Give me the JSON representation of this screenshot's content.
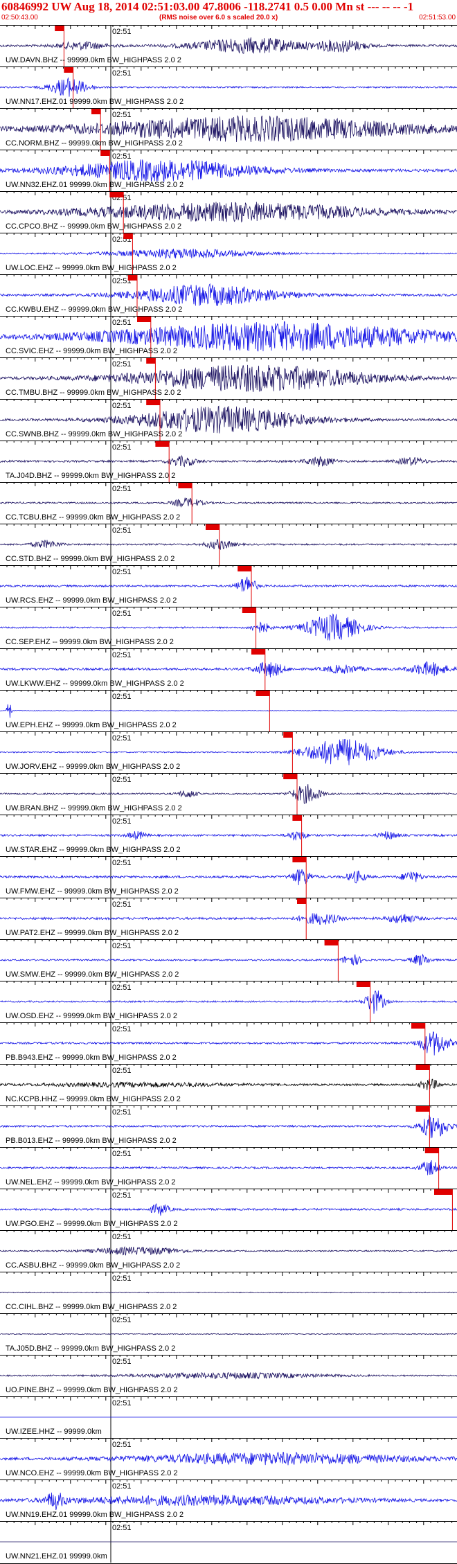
{
  "header": {
    "title": "60846992 UW Aug 18, 2014 02:51:03.00   47.8006 -118.2741  0.5 0.00 Mn st --- -- --  -1",
    "start_time": "02:50:43.00",
    "end_time": "02:51:53.00",
    "note": "(RMS noise over 6.0 s scaled 20.0 x)"
  },
  "minute_label": "02:51",
  "colors": {
    "grid": "#000000",
    "accent": "#e00000",
    "navy": "#1a1060",
    "blue": "#1515e6",
    "black": "#000000"
  },
  "traces": [
    {
      "label": "UW.DAVN.BHZ -- 99999.0km BW_HIGHPASS  2.0  2",
      "color": "navy",
      "amp": 0.35,
      "pick": [
        0.12,
        0.14
      ],
      "bursts": [
        [
          0.55,
          0.12,
          0.8
        ],
        [
          0.75,
          0.05,
          0.6
        ],
        [
          0.18,
          0.05,
          0.4
        ]
      ]
    },
    {
      "label": "UW.NN17.EHZ.01 99999.0km BW_HIGHPASS  2.0  2",
      "color": "blue",
      "amp": 0.25,
      "pick": [
        0.14,
        0.16
      ],
      "bursts": [
        [
          0.15,
          0.04,
          1.0
        ]
      ]
    },
    {
      "label": "CC.NORM.BHZ -- 99999.0km BW_HIGHPASS  2.0  2",
      "color": "navy",
      "amp": 0.45,
      "pick": [
        0.2,
        0.22
      ],
      "bursts": [
        [
          0.55,
          0.35,
          1.3
        ]
      ]
    },
    {
      "label": "UW.NN32.EHZ.01 99999.0km BW_HIGHPASS  2.0  2",
      "color": "blue",
      "amp": 0.45,
      "pick": [
        0.22,
        0.24
      ],
      "bursts": [
        [
          0.35,
          0.2,
          1.1
        ]
      ]
    },
    {
      "label": "CC.CPCO.BHZ -- 99999.0km BW_HIGHPASS  2.0  2",
      "color": "navy",
      "amp": 0.4,
      "pick": [
        0.24,
        0.27
      ],
      "bursts": [
        [
          0.5,
          0.3,
          1.0
        ]
      ]
    },
    {
      "label": "UW.LOC.EHZ -- 99999.0km BW_HIGHPASS  2.0  2",
      "color": "blue",
      "amp": 0.2,
      "pick": [
        0.27,
        0.29
      ],
      "bursts": [
        [
          0.4,
          0.15,
          0.5
        ]
      ]
    },
    {
      "label": "CC.KWBU.EHZ -- 99999.0km BW_HIGHPASS  2.0  2",
      "color": "blue",
      "amp": 0.35,
      "pick": [
        0.28,
        0.3
      ],
      "bursts": [
        [
          0.45,
          0.15,
          1.1
        ]
      ]
    },
    {
      "label": "CC.SVIC.EHZ -- 99999.0km BW_HIGHPASS  2.0  2",
      "color": "blue",
      "amp": 0.5,
      "pick": [
        0.3,
        0.33
      ],
      "bursts": [
        [
          0.6,
          0.35,
          1.5
        ]
      ]
    },
    {
      "label": "CC.TMBU.BHZ -- 99999.0km BW_HIGHPASS  2.0  2",
      "color": "navy",
      "amp": 0.4,
      "pick": [
        0.32,
        0.34
      ],
      "bursts": [
        [
          0.55,
          0.25,
          1.4
        ]
      ]
    },
    {
      "label": "CC.SWNB.BHZ -- 99999.0km BW_HIGHPASS  2.0  2",
      "color": "navy",
      "amp": 0.35,
      "pick": [
        0.32,
        0.35
      ],
      "bursts": [
        [
          0.48,
          0.18,
          1.4
        ]
      ]
    },
    {
      "label": "TA.J04D.BHZ -- 99999.0km BW_HIGHPASS  2.0  2",
      "color": "navy",
      "amp": 0.3,
      "pick": [
        0.34,
        0.37
      ],
      "bursts": [
        [
          0.4,
          0.03,
          0.5
        ],
        [
          0.7,
          0.03,
          0.5
        ],
        [
          0.9,
          0.03,
          0.4
        ]
      ]
    },
    {
      "label": "CC.TCBU.BHZ -- 99999.0km BW_HIGHPASS  2.0  2",
      "color": "navy",
      "amp": 0.25,
      "pick": [
        0.39,
        0.42
      ],
      "bursts": [
        [
          0.41,
          0.03,
          0.5
        ]
      ]
    },
    {
      "label": "CC.STD.BHZ -- 99999.0km BW_HIGHPASS  2.0  2",
      "color": "navy",
      "amp": 0.25,
      "pick": [
        0.45,
        0.48
      ],
      "bursts": [
        [
          0.1,
          0.03,
          0.4
        ],
        [
          0.48,
          0.03,
          0.5
        ]
      ]
    },
    {
      "label": "UW.RCS.EHZ -- 99999.0km BW_HIGHPASS  2.0  2",
      "color": "blue",
      "amp": 0.3,
      "pick": [
        0.52,
        0.55
      ],
      "bursts": [
        [
          0.54,
          0.02,
          1.0
        ]
      ]
    },
    {
      "label": "CC.SEP.EHZ -- 99999.0km BW_HIGHPASS  2.0  2",
      "color": "blue",
      "amp": 0.25,
      "pick": [
        0.53,
        0.56
      ],
      "bursts": [
        [
          0.73,
          0.06,
          1.4
        ],
        [
          0.57,
          0.02,
          0.6
        ]
      ]
    },
    {
      "label": "UW.LKWW.EHZ -- 99999.0km BW_HIGHPASS  2.0  2",
      "color": "blue",
      "amp": 0.35,
      "pick": [
        0.55,
        0.58
      ],
      "bursts": [
        [
          0.59,
          0.03,
          0.8
        ],
        [
          0.94,
          0.04,
          0.7
        ],
        [
          0.75,
          0.04,
          0.4
        ]
      ]
    },
    {
      "label": "UW.EPH.EHZ -- 99999.0km BW_HIGHPASS  2.0  2",
      "color": "blue",
      "amp": 0.1,
      "pick": [
        0.56,
        0.59
      ],
      "bursts": [
        [
          0.02,
          0.005,
          1.0
        ]
      ]
    },
    {
      "label": "UW.JORV.EHZ -- 99999.0km BW_HIGHPASS  2.0  2",
      "color": "blue",
      "amp": 0.2,
      "pick": [
        0.62,
        0.64
      ],
      "bursts": [
        [
          0.75,
          0.08,
          1.5
        ]
      ]
    },
    {
      "label": "UW.BRAN.BHZ -- 99999.0km BW_HIGHPASS  2.0  2",
      "color": "navy",
      "amp": 0.25,
      "pick": [
        0.62,
        0.65
      ],
      "bursts": [
        [
          0.67,
          0.03,
          1.0
        ],
        [
          0.41,
          0.02,
          0.4
        ]
      ]
    },
    {
      "label": "UW.STAR.EHZ -- 99999.0km BW_HIGHPASS  2.0  2",
      "color": "blue",
      "amp": 0.3,
      "pick": [
        0.64,
        0.66
      ],
      "bursts": [
        [
          0.65,
          0.02,
          0.5
        ],
        [
          0.3,
          0.02,
          0.4
        ],
        [
          0.85,
          0.02,
          0.4
        ]
      ]
    },
    {
      "label": "UW.FMW.EHZ -- 99999.0km BW_HIGHPASS  2.0  2",
      "color": "blue",
      "amp": 0.35,
      "pick": [
        0.64,
        0.67
      ],
      "bursts": [
        [
          0.66,
          0.02,
          0.9
        ],
        [
          0.78,
          0.02,
          0.6
        ],
        [
          0.9,
          0.02,
          0.6
        ]
      ]
    },
    {
      "label": "UW.PAT2.EHZ -- 99999.0km BW_HIGHPASS  2.0  2",
      "color": "blue",
      "amp": 0.35,
      "pick": [
        0.65,
        0.67
      ],
      "bursts": [
        [
          0.7,
          0.04,
          0.6
        ],
        [
          0.88,
          0.03,
          0.5
        ]
      ]
    },
    {
      "label": "UW.SMW.EHZ -- 99999.0km BW_HIGHPASS  2.0  2",
      "color": "blue",
      "amp": 0.25,
      "pick": [
        0.71,
        0.74
      ],
      "bursts": [
        [
          0.77,
          0.02,
          0.6
        ],
        [
          0.92,
          0.02,
          0.6
        ]
      ]
    },
    {
      "label": "UW.OSD.EHZ -- 99999.0km BW_HIGHPASS  2.0  2",
      "color": "blue",
      "amp": 0.25,
      "pick": [
        0.78,
        0.81
      ],
      "bursts": [
        [
          0.82,
          0.02,
          1.3
        ]
      ]
    },
    {
      "label": "PB.B943.EHZ -- 99999.0km BW_HIGHPASS  2.0  2",
      "color": "blue",
      "amp": 0.3,
      "pick": [
        0.9,
        0.93
      ],
      "bursts": [
        [
          0.95,
          0.03,
          1.3
        ]
      ]
    },
    {
      "label": "NC.KCPB.HHZ -- 99999.0km BW_HIGHPASS  2.0  2",
      "color": "black",
      "amp": 0.3,
      "pick": [
        0.91,
        0.94
      ],
      "bursts": [
        [
          0.94,
          0.02,
          0.6
        ],
        [
          0.3,
          0.2,
          0.2
        ]
      ]
    },
    {
      "label": "PB.B013.EHZ -- 99999.0km BW_HIGHPASS  2.0  2",
      "color": "blue",
      "amp": 0.3,
      "pick": [
        0.91,
        0.94
      ],
      "bursts": [
        [
          0.95,
          0.03,
          1.3
        ]
      ]
    },
    {
      "label": "UW.NEL.EHZ -- 99999.0km BW_HIGHPASS  2.0  2",
      "color": "blue",
      "amp": 0.3,
      "pick": [
        0.93,
        0.96
      ],
      "bursts": [
        [
          0.94,
          0.02,
          0.8
        ]
      ]
    },
    {
      "label": "UW.PGO.EHZ -- 99999.0km BW_HIGHPASS  2.0  2",
      "color": "blue",
      "amp": 0.3,
      "pick": [
        0.95,
        0.99
      ],
      "bursts": [
        [
          0.35,
          0.02,
          0.6
        ]
      ]
    },
    {
      "label": "CC.ASBU.BHZ -- 99999.0km BW_HIGHPASS  2.0  2",
      "color": "navy",
      "amp": 0.2,
      "pick": null,
      "bursts": [
        [
          0.3,
          0.1,
          0.4
        ]
      ]
    },
    {
      "label": "CC.CIHL.BHZ -- 99999.0km BW_HIGHPASS  2.0  2",
      "color": "navy",
      "amp": 0.15,
      "pick": null,
      "bursts": []
    },
    {
      "label": "TA.J05D.BHZ -- 99999.0km BW_HIGHPASS  2.0  2",
      "color": "navy",
      "amp": 0.15,
      "pick": null,
      "bursts": []
    },
    {
      "label": "UO.PINE.BHZ -- 99999.0km BW_HIGHPASS  2.0  2",
      "color": "navy",
      "amp": 0.2,
      "pick": null,
      "bursts": [
        [
          0.5,
          0.2,
          0.3
        ]
      ]
    },
    {
      "label": "UW.IZEE.HHZ -- 99999.0km",
      "color": "blue",
      "amp": 0.0,
      "pick": null,
      "bursts": []
    },
    {
      "label": "UW.NCO.EHZ -- 99999.0km BW_HIGHPASS  2.0  2",
      "color": "blue",
      "amp": 0.35,
      "pick": null,
      "bursts": [
        [
          0.6,
          0.3,
          0.6
        ]
      ]
    },
    {
      "label": "UW.NN19.EHZ.01 99999.0km BW_HIGHPASS  2.0  2",
      "color": "blue",
      "amp": 0.35,
      "pick": null,
      "bursts": [
        [
          0.12,
          0.02,
          0.8
        ],
        [
          0.45,
          0.3,
          0.5
        ]
      ]
    },
    {
      "label": "UW.NN21.EHZ.01 99999.0km",
      "color": "navy",
      "amp": 0.0,
      "pick": null,
      "bursts": []
    }
  ]
}
